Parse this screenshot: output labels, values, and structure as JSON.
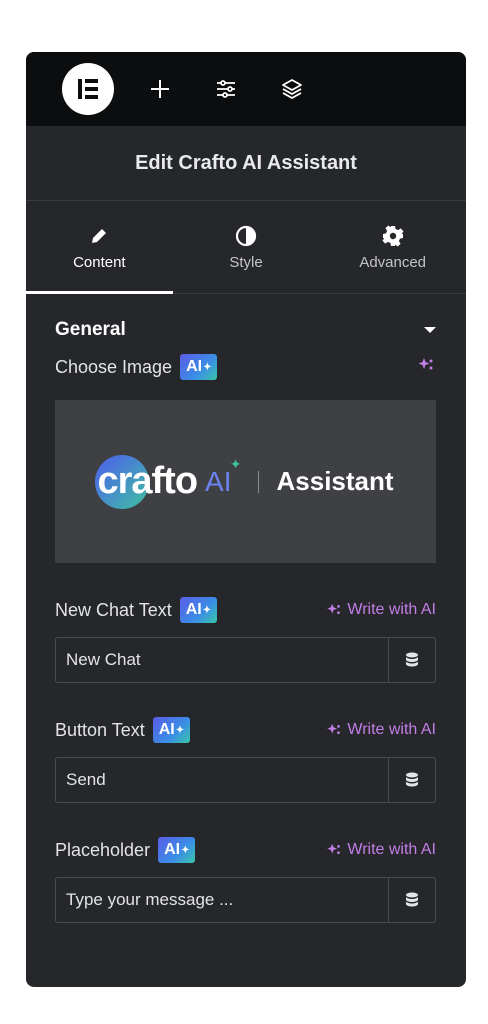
{
  "header": {
    "title": "Edit Crafto AI Assistant",
    "toolbar_icons": [
      "elementor-logo-icon",
      "plus-icon",
      "sliders-icon",
      "layers-icon"
    ]
  },
  "tabs": [
    {
      "label": "Content",
      "icon": "pencil-icon",
      "active": true
    },
    {
      "label": "Style",
      "icon": "contrast-icon",
      "active": false
    },
    {
      "label": "Advanced",
      "icon": "gear-icon",
      "active": false
    }
  ],
  "section": {
    "title": "General"
  },
  "fields": {
    "choose_image": {
      "label": "Choose Image",
      "ai_badge": "AI"
    },
    "image_preview": {
      "brand_text": "crafto",
      "ai_text": "AI",
      "tagline": "Assistant"
    },
    "new_chat": {
      "label": "New Chat Text",
      "ai_badge": "AI",
      "write_label": "Write with AI",
      "value": "New Chat"
    },
    "button": {
      "label": "Button Text",
      "ai_badge": "AI",
      "write_label": "Write with AI",
      "value": "Send"
    },
    "placeholder": {
      "label": "Placeholder",
      "ai_badge": "AI",
      "write_label": "Write with AI",
      "value": "Type your message ..."
    }
  },
  "colors": {
    "panel_bg": "#26272b",
    "topbar_bg": "#0c0d0e",
    "accent_purple": "#c27ee6"
  }
}
